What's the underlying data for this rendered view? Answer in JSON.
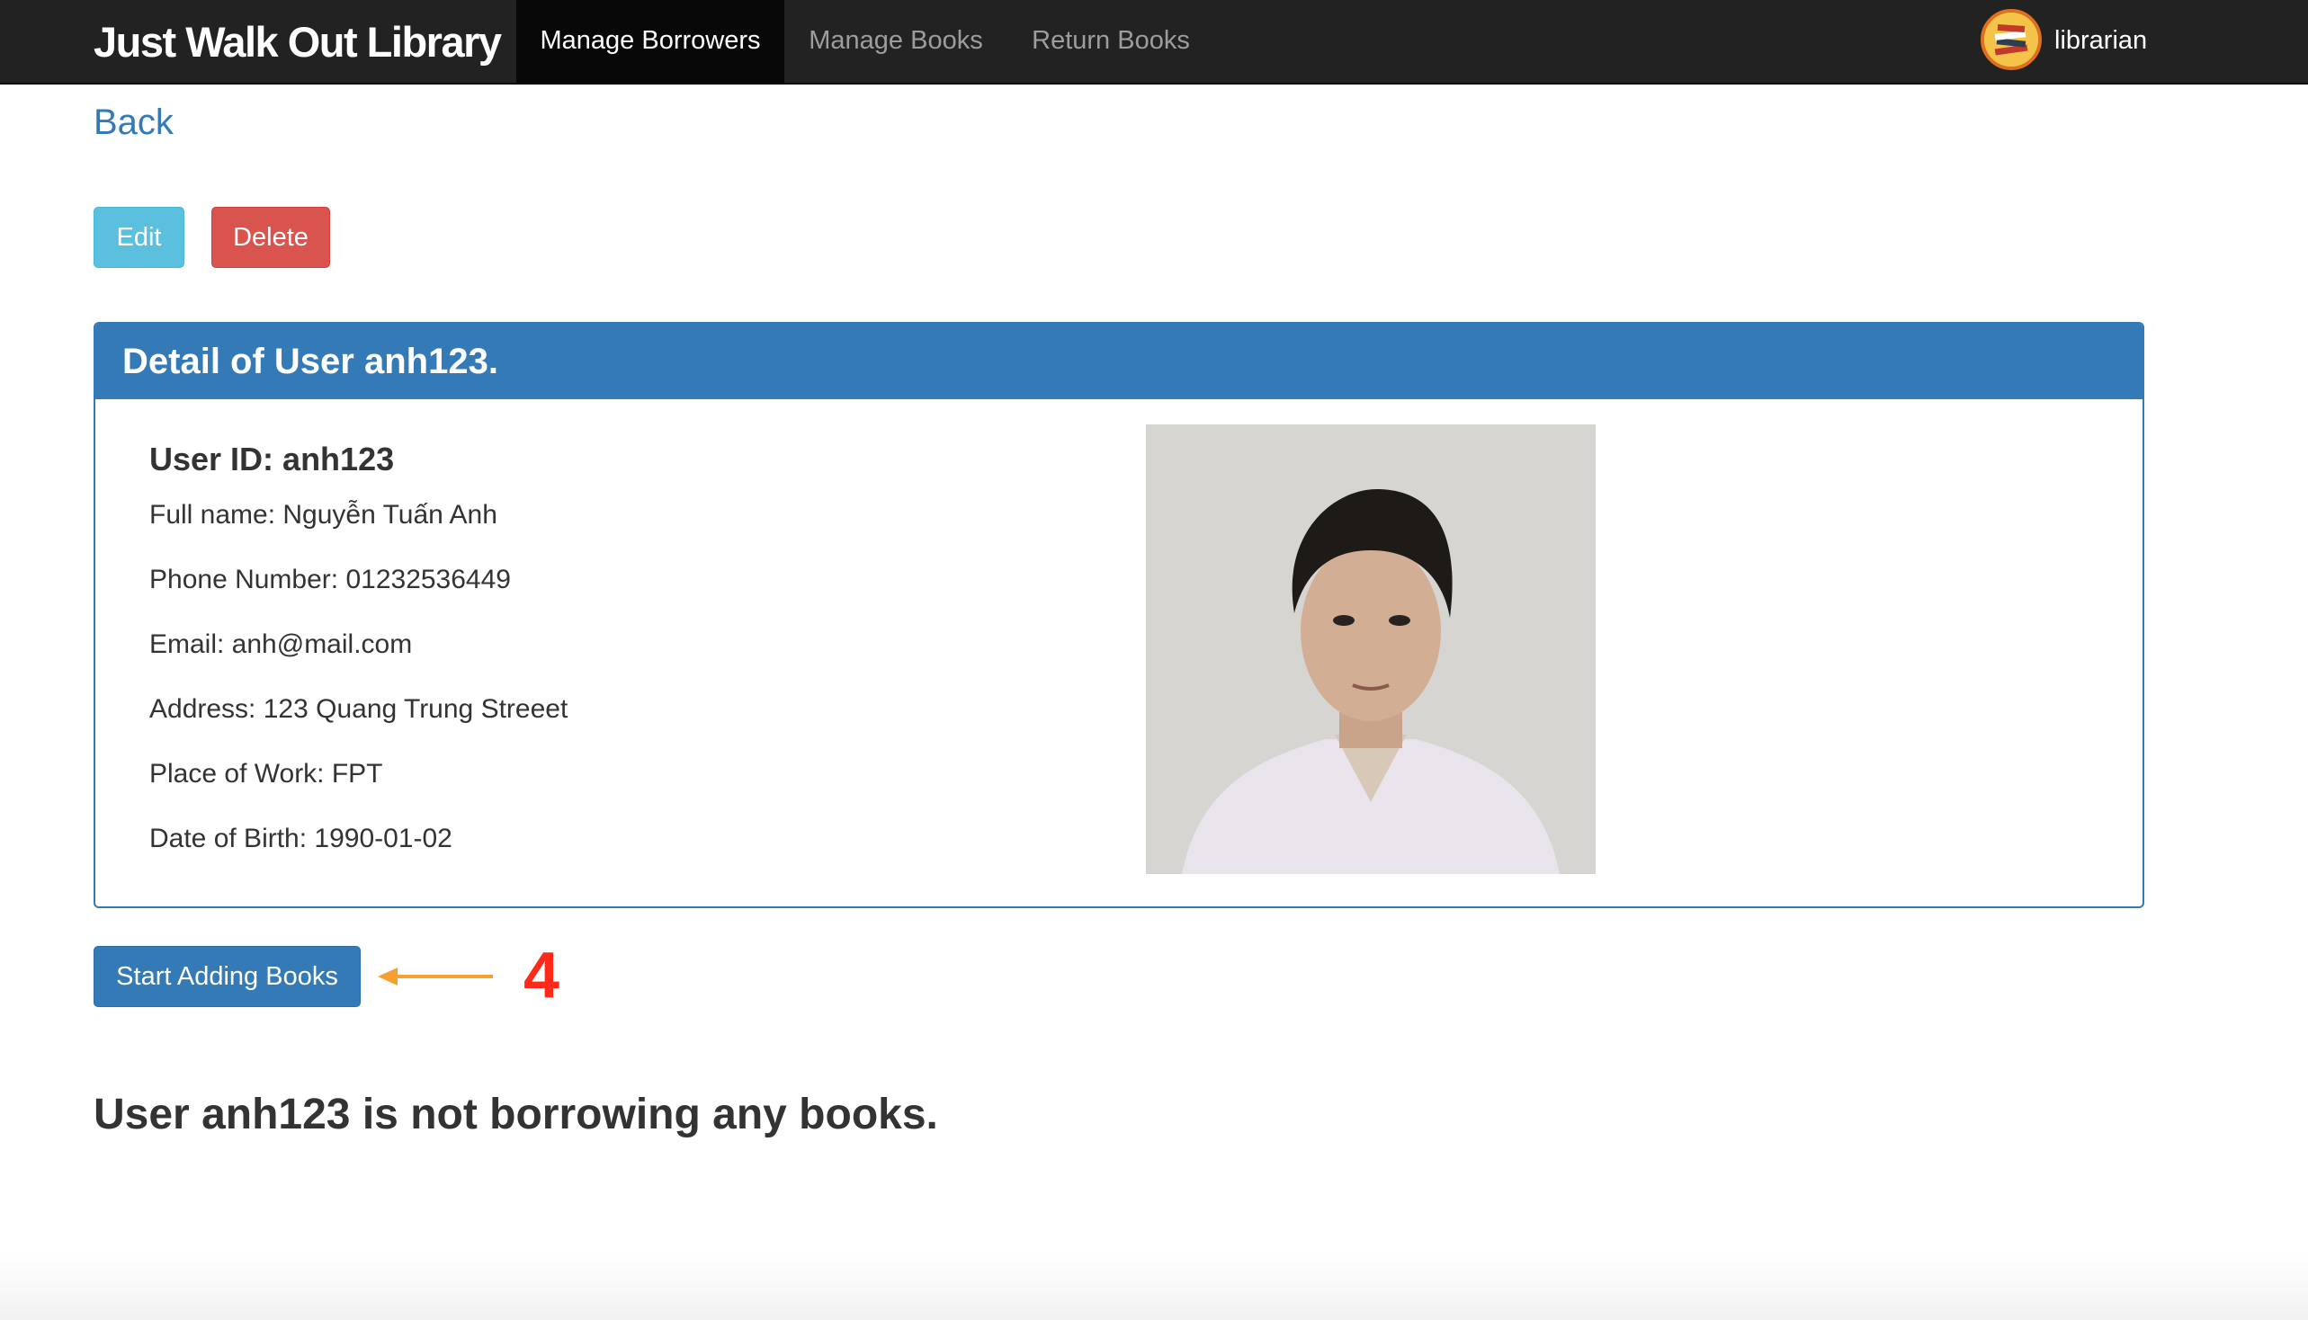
{
  "navbar": {
    "brand": "Just Walk Out Library",
    "links": [
      {
        "label": "Manage Borrowers",
        "active": true
      },
      {
        "label": "Manage Books",
        "active": false
      },
      {
        "label": "Return Books",
        "active": false
      }
    ],
    "user": {
      "name": "librarian",
      "icon": "books-stack-icon"
    }
  },
  "back_link": "Back",
  "actions": {
    "edit_label": "Edit",
    "delete_label": "Delete"
  },
  "panel": {
    "title": "Detail of User anh123.",
    "user_id": "User ID: anh123",
    "details": [
      "Full name: Nguyễn Tuấn Anh",
      "Phone Number: 01232536449",
      "Email: anh@mail.com",
      "Address: 123 Quang Trung Streeet",
      "Place of Work: FPT",
      "Date of Birth: 1990-01-02"
    ]
  },
  "start_button": "Start Adding Books",
  "annotation": {
    "step": "4",
    "color": "#ff2a1a",
    "arrow_color": "#f5a030"
  },
  "status_message": "User anh123 is not borrowing any books.",
  "colors": {
    "primary": "#337ab7",
    "info": "#5bc0de",
    "danger": "#d9534f",
    "navbar": "#222222"
  }
}
